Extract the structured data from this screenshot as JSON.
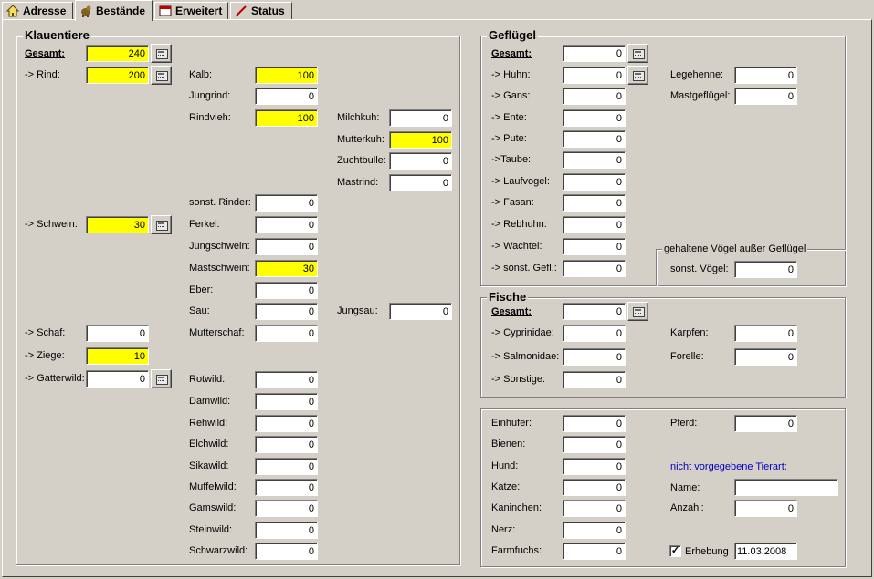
{
  "tabs": [
    {
      "label": "Adresse",
      "icon": "house-icon"
    },
    {
      "label": "Bestände",
      "icon": "animal-icon"
    },
    {
      "label": "Erweitert",
      "icon": "window-icon"
    },
    {
      "label": "Status",
      "icon": "syringe-icon"
    }
  ],
  "klauentiere": {
    "title": "Klauentiere",
    "gesamt": {
      "label": "Gesamt:",
      "value": "240"
    },
    "rind": {
      "label": "-> Rind:",
      "value": "200"
    },
    "kalb": {
      "label": "Kalb:",
      "value": "100"
    },
    "jungrind": {
      "label": "Jungrind:",
      "value": "0"
    },
    "rindvieh": {
      "label": "Rindvieh:",
      "value": "100"
    },
    "milchkuh": {
      "label": "Milchkuh:",
      "value": "0"
    },
    "mutterkuh": {
      "label": "Mutterkuh:",
      "value": "100"
    },
    "zuchtbulle": {
      "label": "Zuchtbulle:",
      "value": "0"
    },
    "mastrind": {
      "label": "Mastrind:",
      "value": "0"
    },
    "sonst_rinder": {
      "label": "sonst. Rinder:",
      "value": "0"
    },
    "schwein": {
      "label": "-> Schwein:",
      "value": "30"
    },
    "ferkel": {
      "label": "Ferkel:",
      "value": "0"
    },
    "jungschwein": {
      "label": "Jungschwein:",
      "value": "0"
    },
    "mastschwein": {
      "label": "Mastschwein:",
      "value": "30"
    },
    "eber": {
      "label": "Eber:",
      "value": "0"
    },
    "sau": {
      "label": "Sau:",
      "value": "0"
    },
    "jungsau": {
      "label": "Jungsau:",
      "value": "0"
    },
    "schaf": {
      "label": "-> Schaf:",
      "value": "0"
    },
    "mutterschaf": {
      "label": "Mutterschaf:",
      "value": "0"
    },
    "ziege": {
      "label": "-> Ziege:",
      "value": "10"
    },
    "gatterwild": {
      "label": "-> Gatterwild:",
      "value": "0"
    },
    "wild": [
      {
        "label": "Rotwild:",
        "value": "0"
      },
      {
        "label": "Damwild:",
        "value": "0"
      },
      {
        "label": "Rehwild:",
        "value": "0"
      },
      {
        "label": "Elchwild:",
        "value": "0"
      },
      {
        "label": "Sikawild:",
        "value": "0"
      },
      {
        "label": "Muffelwild:",
        "value": "0"
      },
      {
        "label": "Gamswild:",
        "value": "0"
      },
      {
        "label": "Steinwild:",
        "value": "0"
      },
      {
        "label": "Schwarzwild:",
        "value": "0"
      }
    ]
  },
  "gefluegel": {
    "title": "Geflügel",
    "gesamt": {
      "label": "Gesamt:",
      "value": "0"
    },
    "items": [
      {
        "label": "-> Huhn:",
        "value": "0"
      },
      {
        "label": "-> Gans:",
        "value": "0"
      },
      {
        "label": "-> Ente:",
        "value": "0"
      },
      {
        "label": "-> Pute:",
        "value": "0"
      },
      {
        "label": "->Taube:",
        "value": "0"
      },
      {
        "label": "-> Laufvogel:",
        "value": "0"
      },
      {
        "label": "-> Fasan:",
        "value": "0"
      },
      {
        "label": "-> Rebhuhn:",
        "value": "0"
      },
      {
        "label": "-> Wachtel:",
        "value": "0"
      },
      {
        "label": "-> sonst. Gefl.:",
        "value": "0"
      }
    ],
    "legehenne": {
      "label": "Legehenne:",
      "value": "0"
    },
    "mastgefluegel": {
      "label": "Mastgeflügel:",
      "value": "0"
    },
    "voegel_title": "gehaltene Vögel außer Geflügel",
    "sonst_voegel": {
      "label": "sonst. Vögel:",
      "value": "0"
    }
  },
  "fische": {
    "title": "Fische",
    "gesamt": {
      "label": "Gesamt:",
      "value": "0"
    },
    "cyprinidae": {
      "label": "-> Cyprinidae:",
      "value": "0"
    },
    "salmonidae": {
      "label": "-> Salmonidae:",
      "value": "0"
    },
    "sonstige": {
      "label": "-> Sonstige:",
      "value": "0"
    },
    "karpfen": {
      "label": "Karpfen:",
      "value": "0"
    },
    "forelle": {
      "label": "Forelle:",
      "value": "0"
    }
  },
  "sonstige": {
    "items": [
      {
        "label": "Einhufer:",
        "value": "0"
      },
      {
        "label": "Bienen:",
        "value": "0"
      },
      {
        "label": "Hund:",
        "value": "0"
      },
      {
        "label": "Katze:",
        "value": "0"
      },
      {
        "label": "Kaninchen:",
        "value": "0"
      },
      {
        "label": "Nerz:",
        "value": "0"
      },
      {
        "label": "Farmfuchs:",
        "value": "0"
      }
    ],
    "pferd": {
      "label": "Pferd:",
      "value": "0"
    },
    "nicht_vorgegeben": "nicht vorgegebene Tierart:",
    "name": {
      "label": "Name:",
      "value": ""
    },
    "anzahl": {
      "label": "Anzahl:",
      "value": "0"
    },
    "erhebung": {
      "label": "Erhebung",
      "checked": "✓",
      "value": "11.03.2008"
    }
  },
  "colors": {
    "highlight": "#ffff00",
    "background": "#d4d0c8",
    "link_blue": "#0000c0"
  }
}
